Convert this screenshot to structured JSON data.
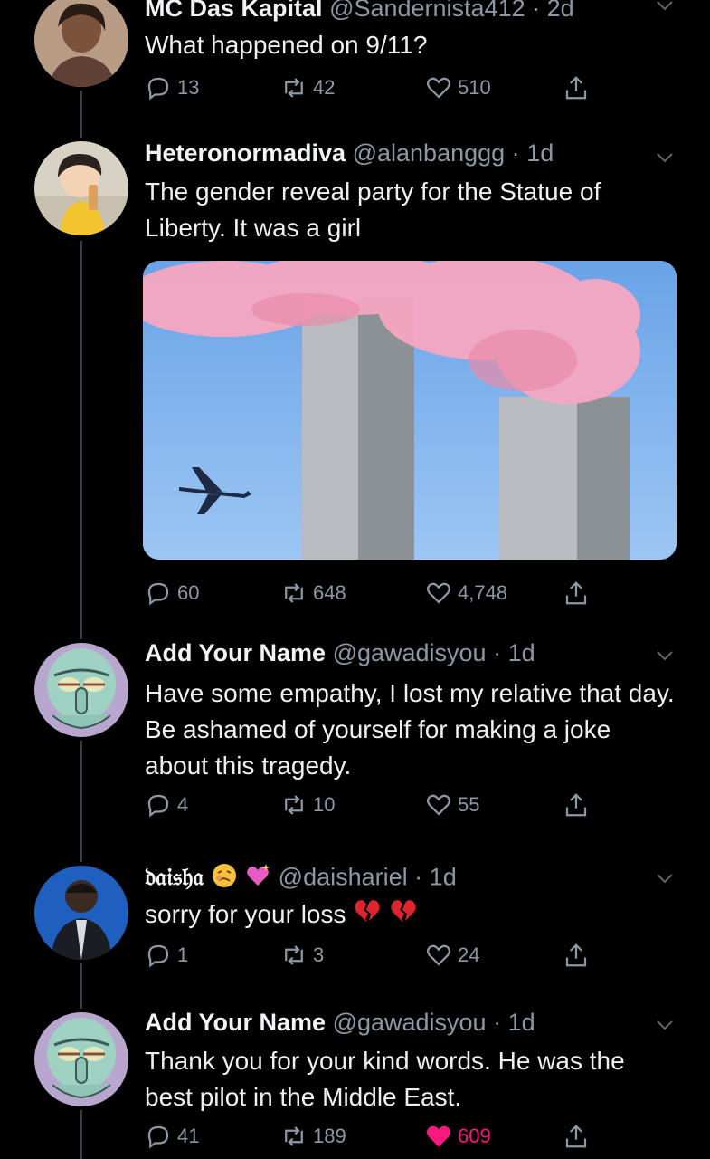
{
  "tweets": [
    {
      "name": "MC Das Kapital",
      "handle": "@Sandernista412",
      "time": "2d",
      "text": "What happened on 9/11?",
      "replies": "13",
      "retweets": "42",
      "likes": "510"
    },
    {
      "name": "Heteronormadiva",
      "handle": "@alanbanggg",
      "time": "1d",
      "text": "The gender reveal party for the Statue of Liberty. It was a girl",
      "replies": "60",
      "retweets": "648",
      "likes": "4,748"
    },
    {
      "name": "Add Your Name",
      "handle": "@gawadisyou",
      "time": "1d",
      "text": "Have some empathy, I lost my relative that day.  Be ashamed of yourself for making a joke about this tragedy.",
      "replies": "4",
      "retweets": "10",
      "likes": "55"
    },
    {
      "name": "𝔡𝔞𝔦𝔰𝔥𝔞",
      "handle": "@daishariel",
      "time": "1d",
      "text": "sorry for your loss",
      "replies": "1",
      "retweets": "3",
      "likes": "24"
    },
    {
      "name": "Add Your Name",
      "handle": "@gawadisyou",
      "time": "1d",
      "text": "Thank you for your kind words. He was the best pilot in the Middle East.",
      "replies": "41",
      "retweets": "189",
      "likes": "609"
    }
  ],
  "separator": "·",
  "colors": {
    "background": "#000000",
    "muted": "#8b98a5",
    "like_active": "#f91880",
    "thread_line": "#3a3d40"
  }
}
